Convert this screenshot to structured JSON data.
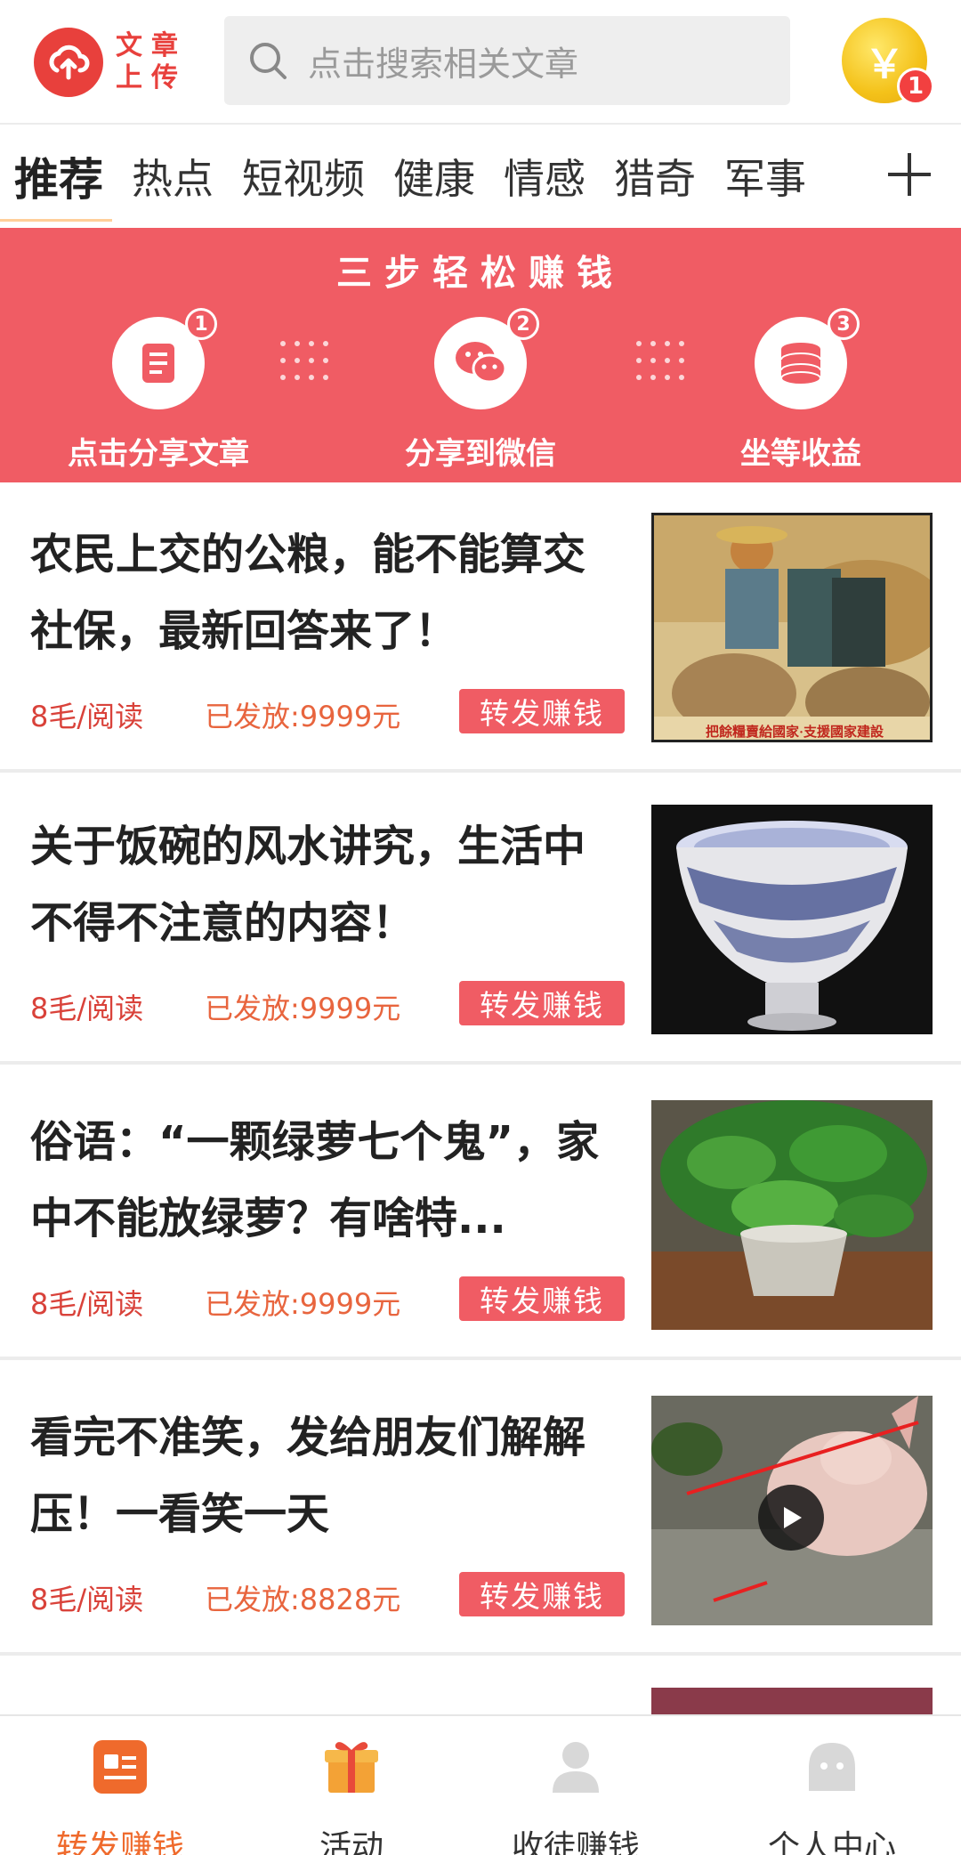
{
  "header": {
    "upload_line1": "文章",
    "upload_line2": "上传",
    "search_placeholder": "点击搜索相关文章",
    "coin_symbol": "￥",
    "coin_badge": "1",
    "brand_color": "#e8403c"
  },
  "tabs": [
    {
      "label": "推荐",
      "active": true
    },
    {
      "label": "热点"
    },
    {
      "label": "短视频"
    },
    {
      "label": "健康"
    },
    {
      "label": "情感"
    },
    {
      "label": "猎奇"
    },
    {
      "label": "军事"
    }
  ],
  "banner": {
    "title": "三步轻松赚钱",
    "color": "#f05c64",
    "steps": [
      {
        "num": "1",
        "label": "点击分享文章",
        "icon": "document-icon"
      },
      {
        "num": "2",
        "label": "分享到微信",
        "icon": "wechat-icon"
      },
      {
        "num": "3",
        "label": "坐等收益",
        "icon": "coins-icon"
      }
    ]
  },
  "articles": [
    {
      "title": "农民上交的公粮，能不能算交社保，最新回答来了！",
      "rate": "8毛/阅读",
      "paid": "已发放:9999元",
      "share": "转发赚钱",
      "thumb_caption": "把餘糧賣給國家·支援國家建設"
    },
    {
      "title": "关于饭碗的风水讲究，生活中不得不注意的内容！",
      "rate": "8毛/阅读",
      "paid": "已发放:9999元",
      "share": "转发赚钱"
    },
    {
      "title": "俗语：“一颗绿萝七个鬼”，家中不能放绿萝？有啥特...",
      "rate": "8毛/阅读",
      "paid": "已发放:9999元",
      "share": "转发赚钱"
    },
    {
      "title": "看完不准笑，发给朋友们解解压！一看笑一天",
      "rate": "8毛/阅读",
      "paid": "已发放:8828元",
      "share": "转发赚钱",
      "video": true
    }
  ],
  "bottom_nav": [
    {
      "label": "转发赚钱",
      "active": true,
      "icon": "news-icon"
    },
    {
      "label": "活动",
      "icon": "gift-icon"
    },
    {
      "label": "收徒赚钱",
      "icon": "user-icon"
    },
    {
      "label": "个人中心",
      "icon": "profile-icon"
    }
  ]
}
